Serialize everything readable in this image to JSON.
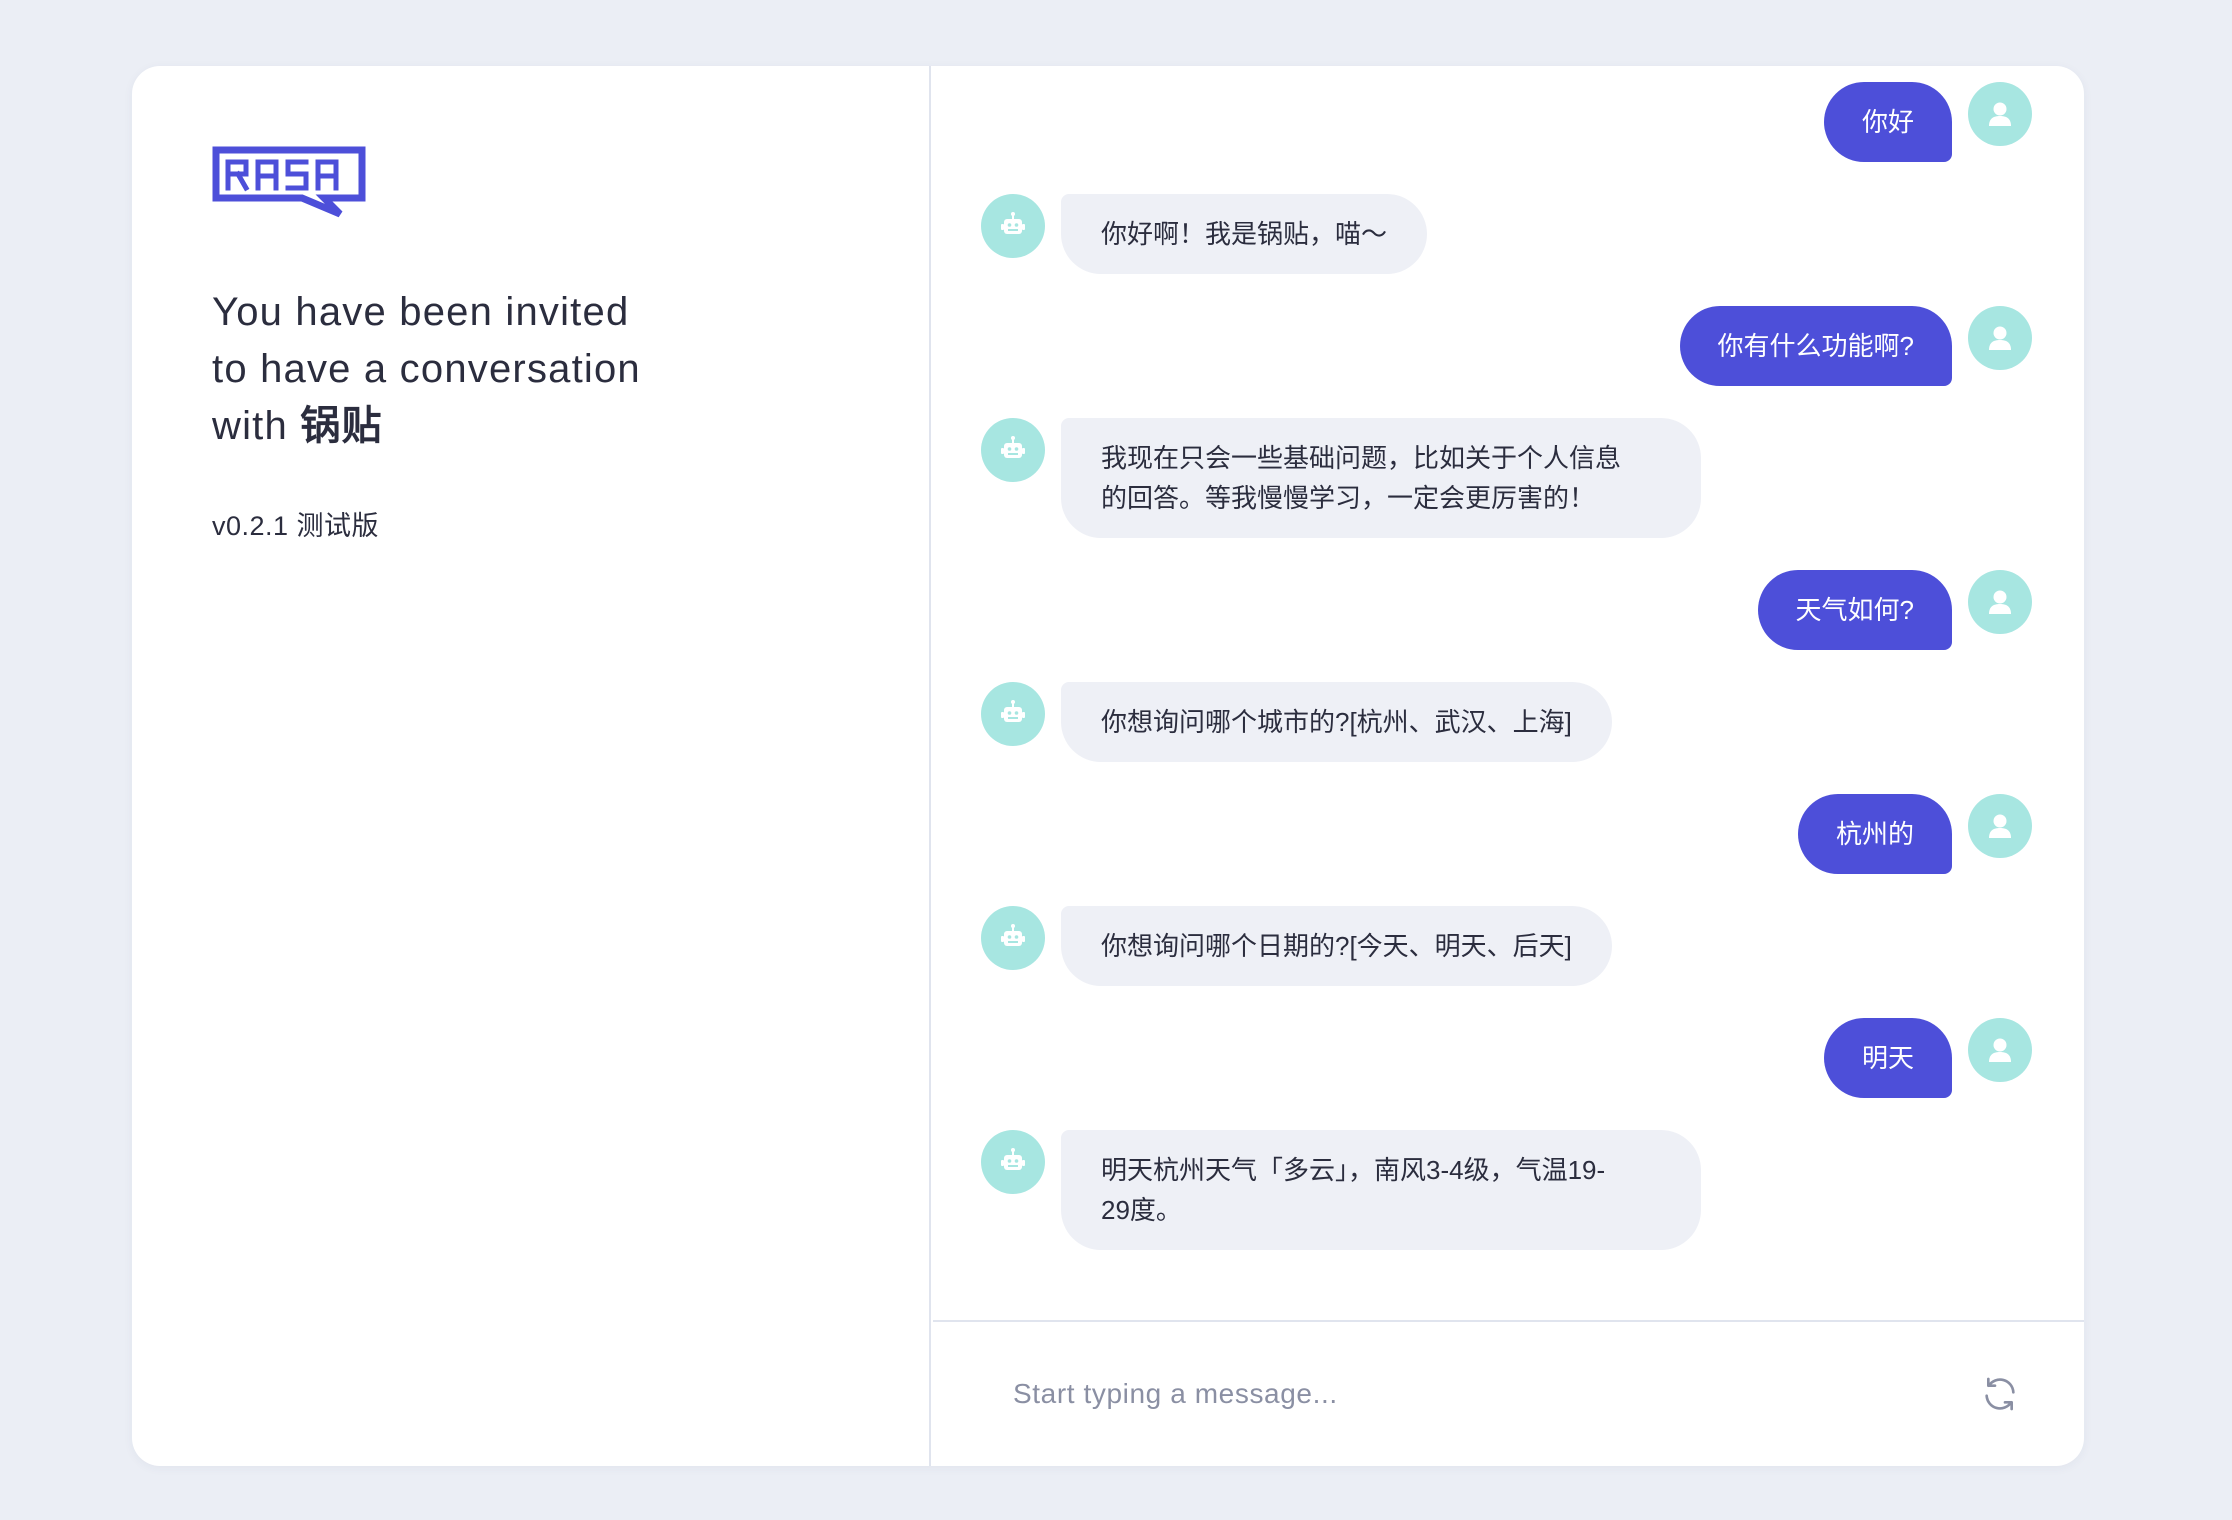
{
  "brand": {
    "logo_text": "RASA",
    "color": "#4d4fd9"
  },
  "intro": {
    "line1": "You have been invited",
    "line2": "to have a conversation",
    "line3_prefix": "with",
    "bot_name": "锅贴",
    "version": "v0.2.1 测试版"
  },
  "colors": {
    "user_bubble": "#4d4fd9",
    "bot_bubble": "#eef0f6",
    "avatar_bg": "#a7e6e1",
    "text": "#2b2d3e"
  },
  "messages": [
    {
      "sender": "user",
      "text": "你好"
    },
    {
      "sender": "bot",
      "text": "你好啊！我是锅贴，喵～"
    },
    {
      "sender": "user",
      "text": "你有什么功能啊?"
    },
    {
      "sender": "bot",
      "lines": [
        "我现在只会一些基础问题，比如关于个人信息",
        "的回答。等我慢慢学习，一定会更厉害的！"
      ]
    },
    {
      "sender": "user",
      "text": "天气如何?"
    },
    {
      "sender": "bot",
      "text": "你想询问哪个城市的?[杭州、武汉、上海]"
    },
    {
      "sender": "user",
      "text": "杭州的"
    },
    {
      "sender": "bot",
      "text": "你想询问哪个日期的?[今天、明天、后天]"
    },
    {
      "sender": "user",
      "text": "明天"
    },
    {
      "sender": "bot",
      "lines": [
        "明天杭州天气「多云」，南风3-4级，气温19-",
        "29度。"
      ]
    }
  ],
  "composer": {
    "placeholder": "Start typing a message...",
    "value": "",
    "refresh_icon": "refresh-icon",
    "send_icon": "send-icon"
  },
  "icons": {
    "user_avatar": "user-icon",
    "bot_avatar": "robot-icon"
  }
}
